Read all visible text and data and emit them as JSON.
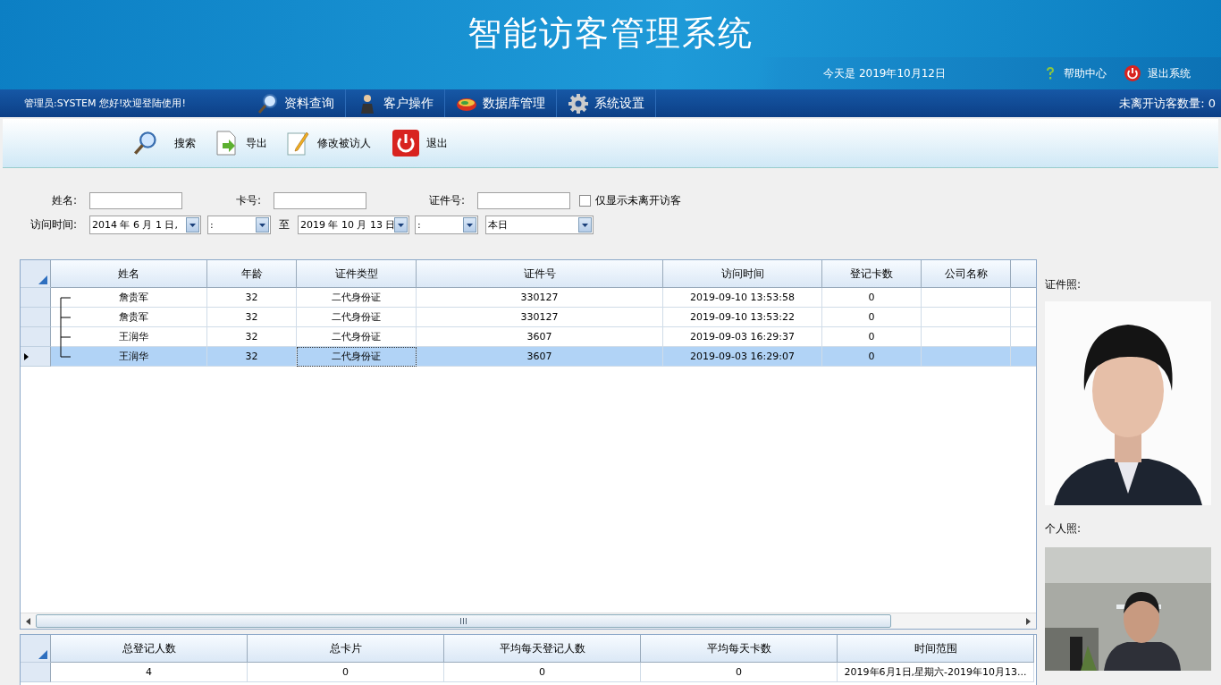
{
  "header": {
    "title": "智能访客管理系统",
    "date": "今天是 2019年10月12日",
    "links": [
      {
        "kind": "help",
        "label": "帮助中心"
      },
      {
        "kind": "power",
        "label": "退出系统"
      }
    ]
  },
  "navbar": {
    "greeting": "管理员:SYSTEM 您好!欢迎登陆使用!",
    "menu": [
      {
        "kind": "search",
        "label": "资料查询"
      },
      {
        "kind": "person",
        "label": "客户操作"
      },
      {
        "kind": "database",
        "label": "数据库管理"
      },
      {
        "kind": "gear",
        "label": "系统设置"
      }
    ],
    "visitor_count": "未离开访客数量: 0"
  },
  "toolbar": [
    {
      "kind": "search",
      "label": "搜索"
    },
    {
      "kind": "export",
      "label": "导出"
    },
    {
      "kind": "edit",
      "label": "修改被访人"
    },
    {
      "kind": "power",
      "label": "退出"
    }
  ],
  "filters": {
    "name_label": "姓名:",
    "card_label": "卡号:",
    "id_label": "证件号:",
    "only_present": {
      "label": "仅显示未离开访客",
      "checked": false
    },
    "time_label": "访问时间:",
    "from_date": "2014 年 6 月 1 日,",
    "from_time": ":",
    "to_label": "至",
    "to_date": "2019 年 10 月 13 日",
    "to_time": ":",
    "range": "本日"
  },
  "table": {
    "columns": [
      "姓名",
      "年龄",
      "证件类型",
      "证件号",
      "访问时间",
      "登记卡数",
      "公司名称"
    ],
    "rows": [
      {
        "cells": [
          "詹贵军",
          "32",
          "二代身份证",
          "330127",
          "2019-09-10 13:53:58",
          "0"
        ],
        "selected": false
      },
      {
        "cells": [
          "詹贵军",
          "32",
          "二代身份证",
          "330127",
          "2019-09-10 13:53:22",
          "0"
        ],
        "selected": false
      },
      {
        "cells": [
          "王润华",
          "32",
          "二代身份证",
          "3607",
          "2019-09-03 16:29:37",
          "0"
        ],
        "selected": false
      },
      {
        "cells": [
          "王润华",
          "32",
          "二代身份证",
          "3607",
          "2019-09-03 16:29:07",
          "0"
        ],
        "selected": true
      }
    ]
  },
  "summary": {
    "columns": [
      "总登记人数",
      "总卡片",
      "平均每天登记人数",
      "平均每天卡数",
      "时间范围"
    ],
    "row": [
      "4",
      "0",
      "0",
      "0",
      "2019年6月1日,星期六-2019年10月13..."
    ]
  },
  "photos": {
    "id_label": "证件照:",
    "personal_label": "个人照:"
  }
}
